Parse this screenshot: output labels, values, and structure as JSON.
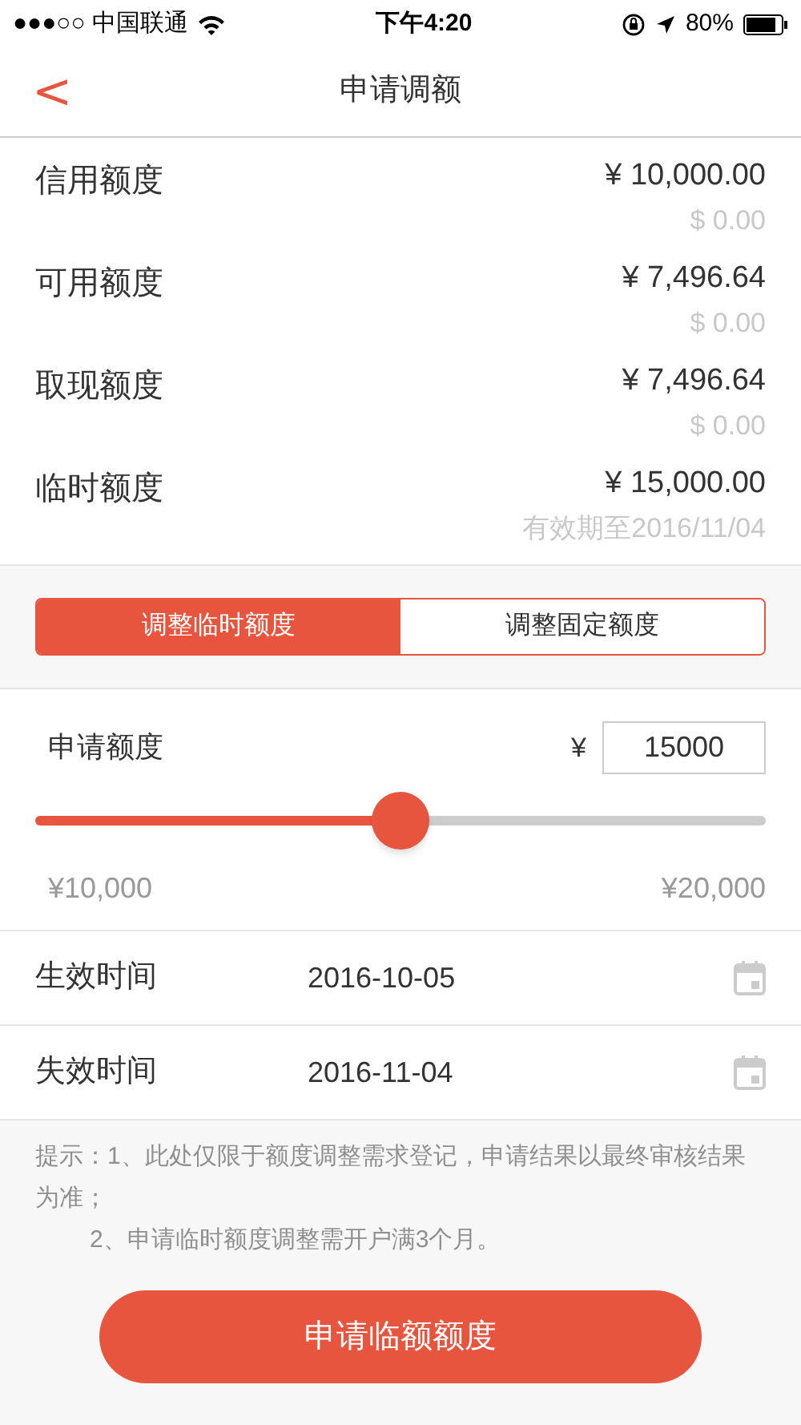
{
  "status_bar": {
    "carrier": "●●●○○ 中国联通",
    "time": "下午4:20",
    "battery": "80%"
  },
  "nav": {
    "back": "<",
    "title": "申请调额"
  },
  "limits": [
    {
      "label": "信用额度",
      "amount": "¥ 10,000.00",
      "sub": "$ 0.00"
    },
    {
      "label": "可用额度",
      "amount": "¥ 7,496.64",
      "sub": "$ 0.00"
    },
    {
      "label": "取现额度",
      "amount": "¥ 7,496.64",
      "sub": "$ 0.00"
    },
    {
      "label": "临时额度",
      "amount": "¥ 15,000.00",
      "sub": "有效期至2016/11/04"
    }
  ],
  "tabs": [
    {
      "label": "调整临时额度",
      "selected": true
    },
    {
      "label": "调整固定额度",
      "selected": false
    }
  ],
  "request": {
    "label": "申请额度",
    "currency": "¥",
    "value": "15000",
    "level": 0.5,
    "min": "¥10,000",
    "max": "¥20,000"
  },
  "dates": [
    {
      "label": "生效时间",
      "value": "2016-10-05"
    },
    {
      "label": "失效时间",
      "value": "2016-11-04"
    }
  ],
  "tips": [
    "提示：1、此处仅限于额度调整需求登记，申请结果以最终审核结果为准；",
    "2、申请临时额度调整需开户满3个月。"
  ],
  "submit": "申请临额额度"
}
